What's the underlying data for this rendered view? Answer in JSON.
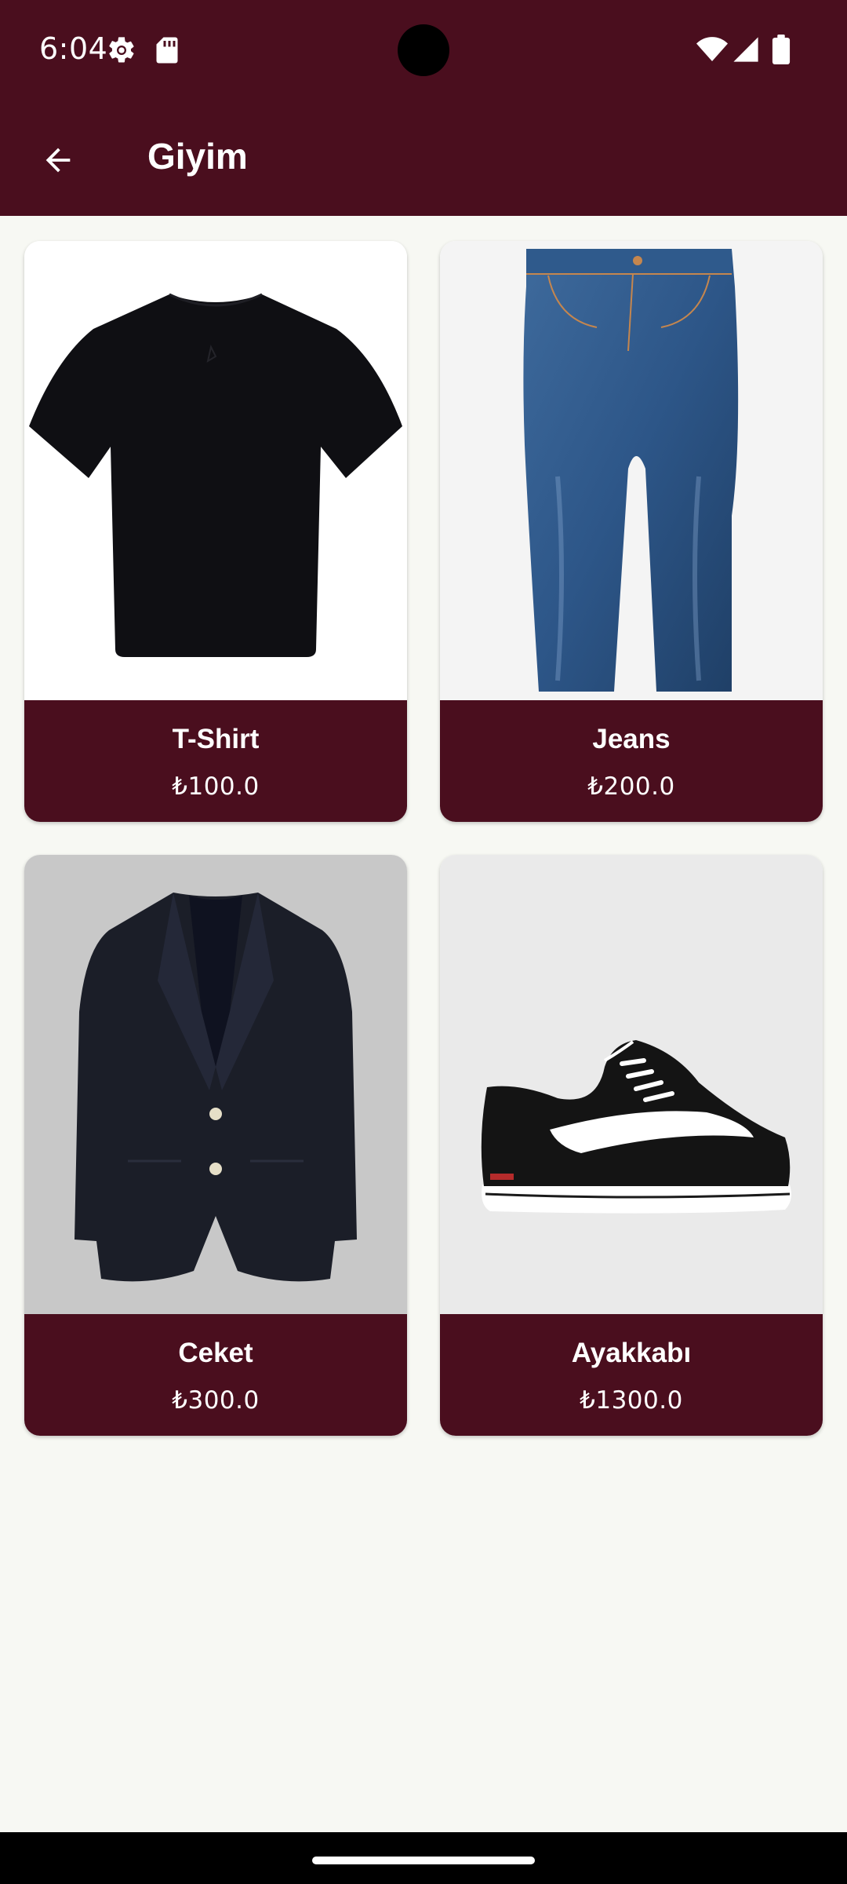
{
  "status_bar": {
    "time": "6:04",
    "icons": [
      "settings-gear-icon",
      "sd-card-icon",
      "wifi-icon",
      "cell-signal-icon",
      "battery-icon"
    ]
  },
  "app_bar": {
    "title": "Giyim",
    "back_icon": "arrow-back-icon",
    "background_color": "#4a0e1e"
  },
  "products": [
    {
      "name": "T-Shirt",
      "price": "₺100.0",
      "image": "black-tshirt"
    },
    {
      "name": "Jeans",
      "price": "₺200.0",
      "image": "blue-jeans"
    },
    {
      "name": "Ceket",
      "price": "₺300.0",
      "image": "black-blazer"
    },
    {
      "name": "Ayakkabı",
      "price": "₺1300.0",
      "image": "black-white-sneaker"
    }
  ],
  "colors": {
    "primary": "#4a0e1e",
    "page_background": "#f7f8f3",
    "on_primary": "#ffffff"
  }
}
